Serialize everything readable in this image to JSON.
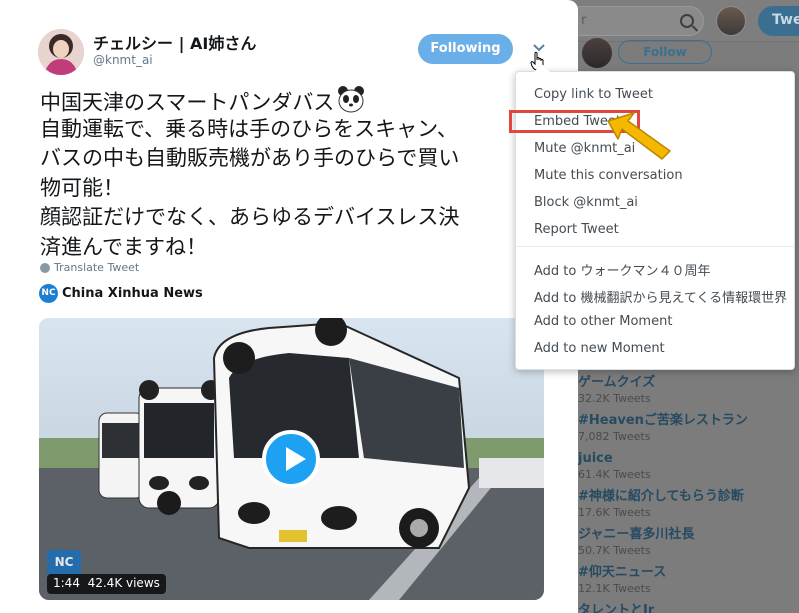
{
  "header": {
    "search_placeholder": "r",
    "tweet_button": "Twee"
  },
  "sidebar": {
    "follow_label": "Follow",
    "trends": [
      {
        "name": "ゲームクイズ",
        "count": "32.2K Tweets"
      },
      {
        "name": "#Heavenご苦楽レストラン",
        "count": "7,082 Tweets"
      },
      {
        "name": "juice",
        "count": "61.4K Tweets"
      },
      {
        "name": "#神様に紹介してもらう診断",
        "count": "17.6K Tweets"
      },
      {
        "name": "ジャニー喜多川社長",
        "count": "50.7K Tweets"
      },
      {
        "name": "#仰天ニュース",
        "count": "12.1K Tweets"
      },
      {
        "name": "タレントとJr",
        "count": ""
      }
    ]
  },
  "tweet": {
    "author_name": "チェルシー | AI姉さん",
    "author_handle": "@knmt_ai",
    "following_label": "Following",
    "text_lines": [
      "中国天津のスマートパンダバス",
      "自動運転で、乗る時は手のひらをスキャン、",
      "バスの中も自動販売機があり手のひらで買い",
      "物可能！",
      "顔認証だけでなく、あらゆるデバイスレス決",
      "済進んでますね！"
    ],
    "translate_label": "Translate Tweet",
    "source_name": "China Xinhua News",
    "source_logo_text": "NC",
    "video": {
      "duration": "1:44",
      "views": "42.4K views",
      "watermark": "NC"
    }
  },
  "menu": {
    "items": [
      "Copy link to Tweet",
      "Embed Tweet",
      "Mute @knmt_ai",
      "Mute this conversation",
      "Block @knmt_ai",
      "Report Tweet",
      "Add to ウォークマン４０周年",
      "Add to 機械翻訳から見えてくる情報環世界",
      "Add to other Moment",
      "Add to new Moment"
    ]
  },
  "colors": {
    "accent": "#1da1f2",
    "following_button": "#6bafe8",
    "highlight": "#e0473e",
    "arrow": "#f5b700"
  }
}
